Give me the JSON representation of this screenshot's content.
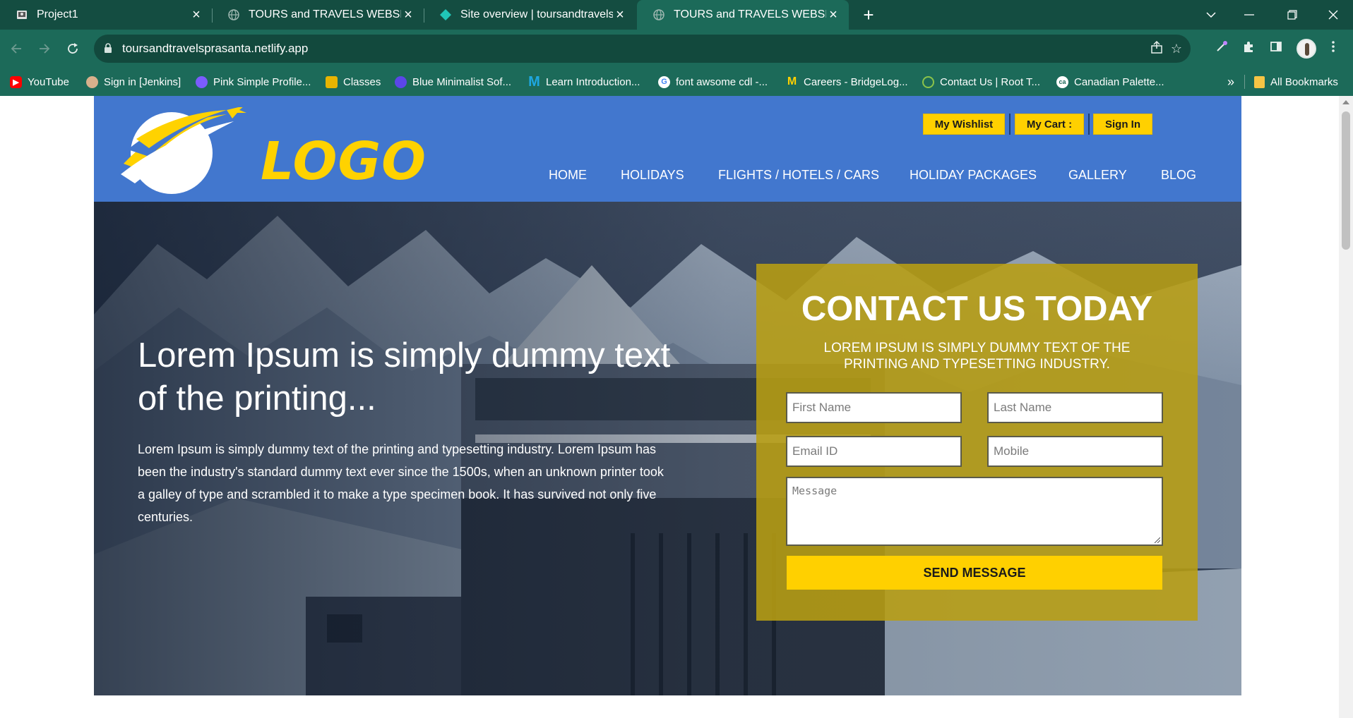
{
  "browser": {
    "tabs": [
      {
        "title": "Project1",
        "icon": "slides-icon",
        "active": false
      },
      {
        "title": "TOURS and TRAVELS WEBSITE",
        "icon": "globe-icon",
        "active": false
      },
      {
        "title": "Site overview | toursandtravelspr",
        "icon": "netlify-icon",
        "active": false
      },
      {
        "title": "TOURS and TRAVELS WEBSITE",
        "icon": "globe-icon",
        "active": true
      }
    ],
    "address": "toursandtravelsprasanta.netlify.app",
    "bookmarks": [
      {
        "label": "YouTube",
        "icon": "youtube-icon",
        "color": "#ff0000"
      },
      {
        "label": "Sign in [Jenkins]",
        "icon": "jenkins-icon",
        "color": "#d8b08c"
      },
      {
        "label": "Pink Simple Profile...",
        "icon": "canva-icon",
        "color": "#7b5cff"
      },
      {
        "label": "Classes",
        "icon": "classroom-icon",
        "color": "#e8b400"
      },
      {
        "label": "Blue Minimalist Sof...",
        "icon": "canva-icon",
        "color": "#5b46e8"
      },
      {
        "label": "Learn Introduction...",
        "icon": "m-icon",
        "color": "#1ea7e1"
      },
      {
        "label": "font awsome cdl -...",
        "icon": "google-icon",
        "color": "#ffffff"
      },
      {
        "label": "Careers - BridgeLog...",
        "icon": "bridgelabz-icon",
        "color": "#ffd000"
      },
      {
        "label": "Contact Us | Root T...",
        "icon": "roottech-icon",
        "color": "#8bc34a"
      },
      {
        "label": "Canadian Palette...",
        "icon": "ca-icon",
        "color": "#ffffff"
      }
    ],
    "more_bookmarks": "»",
    "all_bookmarks": "All Bookmarks"
  },
  "site": {
    "logo_text": "LOGO",
    "top_buttons": [
      "My Wishlist",
      "My Cart :",
      "Sign In"
    ],
    "menu": [
      "HOME",
      "HOLIDAYS",
      "FLIGHTS / HOTELS / CARS",
      "HOLIDAY PACKAGES",
      "GALLERY",
      "BLOG"
    ],
    "hero": {
      "title": "Lorem Ipsum is simply dummy text of the printing...",
      "text": "Lorem Ipsum is simply dummy text of the printing and typesetting industry. Lorem Ipsum has been the industry's standard dummy text ever since the 1500s, when an unknown printer took a galley of type and scrambled it to make a type specimen book. It has survived not only five centuries."
    },
    "contact": {
      "title": "CONTACT US TODAY",
      "subtitle": "LOREM IPSUM IS SIMPLY DUMMY TEXT OF THE PRINTING AND TYPESETTING INDUSTRY.",
      "first_name_placeholder": "First Name",
      "last_name_placeholder": "Last Name",
      "email_placeholder": "Email ID",
      "mobile_placeholder": "Mobile",
      "message_placeholder": "Message",
      "send_label": "SEND MESSAGE"
    }
  },
  "colors": {
    "chrome_dark": "#144d41",
    "chrome": "#1c6a59",
    "header_blue": "#4277ce",
    "accent_yellow": "#ffd000",
    "contact_panel": "#b89e12"
  }
}
